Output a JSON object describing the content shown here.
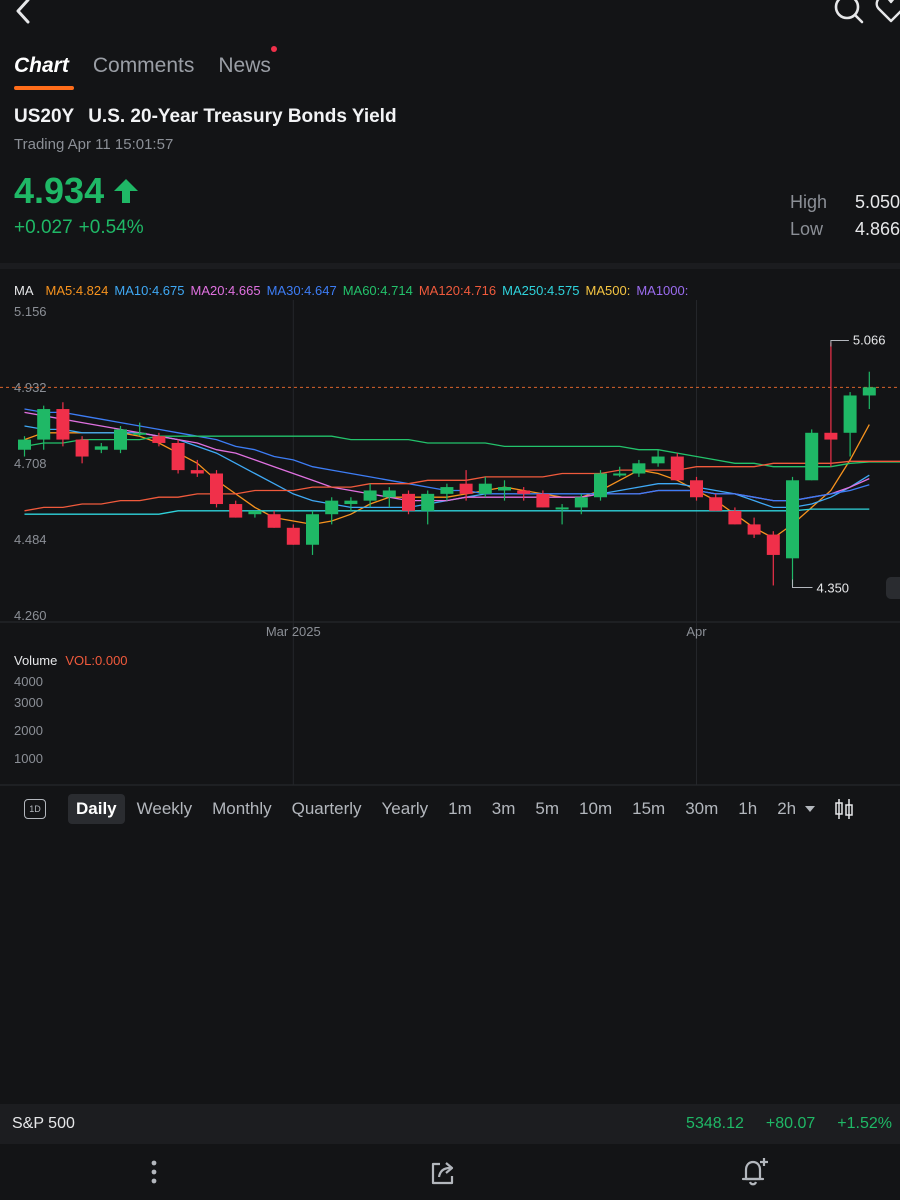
{
  "header": {
    "back_icon": "chevron-left-icon",
    "search_icon": "search-icon",
    "favorite_icon": "heart-icon"
  },
  "tabs": [
    {
      "label": "Chart",
      "active": true
    },
    {
      "label": "Comments",
      "active": false
    },
    {
      "label": "News",
      "active": false,
      "has_dot": true
    }
  ],
  "quote": {
    "symbol": "US20Y",
    "name": "U.S. 20-Year Treasury Bonds Yield",
    "status": "Trading Apr 11 15:01:57",
    "price": "4.934",
    "change": "+0.027",
    "change_pct": "+0.54%",
    "high_label": "High",
    "high": "5.050",
    "low_label": "Low",
    "low": "4.866",
    "up_color": "#1fb866",
    "down_color": "#f0304a"
  },
  "ma_legend": {
    "label": "MA",
    "items": [
      {
        "text": "MA5:4.824",
        "color": "#f7931e"
      },
      {
        "text": "MA10:4.675",
        "color": "#3fa9f5"
      },
      {
        "text": "MA20:4.665",
        "color": "#e071e0"
      },
      {
        "text": "MA30:4.647",
        "color": "#3d7df5"
      },
      {
        "text": "MA60:4.714",
        "color": "#23c26b"
      },
      {
        "text": "MA120:4.716",
        "color": "#f05a3c"
      },
      {
        "text": "MA250:4.575",
        "color": "#2fd3dc"
      },
      {
        "text": "MA500:",
        "color": "#f5c542"
      },
      {
        "text": "MA1000:",
        "color": "#9b6cf0"
      }
    ]
  },
  "chart_data": {
    "type": "candlestick",
    "y_ticks": [
      "5.156",
      "4.932",
      "4.708",
      "4.484",
      "4.260"
    ],
    "ylim": [
      4.26,
      5.156
    ],
    "x_labels": [
      {
        "text": "Mar 2025",
        "index": 14
      },
      {
        "text": "Apr",
        "index": 35
      }
    ],
    "current_price": 4.934,
    "high_marker": {
      "text": "5.066",
      "index": 42
    },
    "low_marker": {
      "text": "4.350",
      "index": 39
    },
    "candles": [
      {
        "o": 4.75,
        "h": 4.79,
        "l": 4.73,
        "c": 4.78
      },
      {
        "o": 4.78,
        "h": 4.88,
        "l": 4.75,
        "c": 4.87
      },
      {
        "o": 4.87,
        "h": 4.89,
        "l": 4.76,
        "c": 4.78
      },
      {
        "o": 4.78,
        "h": 4.79,
        "l": 4.71,
        "c": 4.73
      },
      {
        "o": 4.75,
        "h": 4.77,
        "l": 4.74,
        "c": 4.76
      },
      {
        "o": 4.75,
        "h": 4.82,
        "l": 4.74,
        "c": 4.81
      },
      {
        "o": 4.8,
        "h": 4.83,
        "l": 4.79,
        "c": 4.8
      },
      {
        "o": 4.79,
        "h": 4.8,
        "l": 4.76,
        "c": 4.77
      },
      {
        "o": 4.77,
        "h": 4.78,
        "l": 4.68,
        "c": 4.69
      },
      {
        "o": 4.69,
        "h": 4.72,
        "l": 4.67,
        "c": 4.68
      },
      {
        "o": 4.68,
        "h": 4.69,
        "l": 4.58,
        "c": 4.59
      },
      {
        "o": 4.59,
        "h": 4.6,
        "l": 4.55,
        "c": 4.55
      },
      {
        "o": 4.56,
        "h": 4.57,
        "l": 4.55,
        "c": 4.57
      },
      {
        "o": 4.56,
        "h": 4.57,
        "l": 4.52,
        "c": 4.52
      },
      {
        "o": 4.52,
        "h": 4.53,
        "l": 4.47,
        "c": 4.47
      },
      {
        "o": 4.47,
        "h": 4.57,
        "l": 4.44,
        "c": 4.56
      },
      {
        "o": 4.56,
        "h": 4.61,
        "l": 4.53,
        "c": 4.6
      },
      {
        "o": 4.59,
        "h": 4.61,
        "l": 4.57,
        "c": 4.6
      },
      {
        "o": 4.6,
        "h": 4.65,
        "l": 4.58,
        "c": 4.63
      },
      {
        "o": 4.61,
        "h": 4.64,
        "l": 4.58,
        "c": 4.63
      },
      {
        "o": 4.62,
        "h": 4.63,
        "l": 4.56,
        "c": 4.57
      },
      {
        "o": 4.57,
        "h": 4.63,
        "l": 4.53,
        "c": 4.62
      },
      {
        "o": 4.62,
        "h": 4.65,
        "l": 4.6,
        "c": 4.64
      },
      {
        "o": 4.65,
        "h": 4.69,
        "l": 4.6,
        "c": 4.62
      },
      {
        "o": 4.62,
        "h": 4.67,
        "l": 4.61,
        "c": 4.65
      },
      {
        "o": 4.63,
        "h": 4.66,
        "l": 4.6,
        "c": 4.64
      },
      {
        "o": 4.63,
        "h": 4.64,
        "l": 4.6,
        "c": 4.62
      },
      {
        "o": 4.62,
        "h": 4.63,
        "l": 4.58,
        "c": 4.58
      },
      {
        "o": 4.58,
        "h": 4.59,
        "l": 4.53,
        "c": 4.58
      },
      {
        "o": 4.58,
        "h": 4.62,
        "l": 4.56,
        "c": 4.61
      },
      {
        "o": 4.61,
        "h": 4.69,
        "l": 4.6,
        "c": 4.68
      },
      {
        "o": 4.68,
        "h": 4.7,
        "l": 4.67,
        "c": 4.68
      },
      {
        "o": 4.68,
        "h": 4.72,
        "l": 4.67,
        "c": 4.71
      },
      {
        "o": 4.71,
        "h": 4.75,
        "l": 4.7,
        "c": 4.73
      },
      {
        "o": 4.73,
        "h": 4.74,
        "l": 4.66,
        "c": 4.66
      },
      {
        "o": 4.66,
        "h": 4.67,
        "l": 4.6,
        "c": 4.61
      },
      {
        "o": 4.61,
        "h": 4.62,
        "l": 4.57,
        "c": 4.57
      },
      {
        "o": 4.57,
        "h": 4.58,
        "l": 4.53,
        "c": 4.53
      },
      {
        "o": 4.53,
        "h": 4.55,
        "l": 4.49,
        "c": 4.5
      },
      {
        "o": 4.5,
        "h": 4.51,
        "l": 4.35,
        "c": 4.44
      },
      {
        "o": 4.43,
        "h": 4.67,
        "l": 4.35,
        "c": 4.66
      },
      {
        "o": 4.66,
        "h": 4.81,
        "l": 4.66,
        "c": 4.8
      },
      {
        "o": 4.8,
        "h": 5.066,
        "l": 4.7,
        "c": 4.78
      },
      {
        "o": 4.8,
        "h": 4.92,
        "l": 4.73,
        "c": 4.91
      },
      {
        "o": 4.91,
        "h": 4.98,
        "l": 4.87,
        "c": 4.934
      }
    ],
    "ma_series": [
      {
        "name": "MA5",
        "color": "#f7931e",
        "values": [
          4.78,
          4.8,
          4.8,
          4.8,
          4.8,
          4.8,
          4.79,
          4.77,
          4.74,
          4.71,
          4.66,
          4.62,
          4.58,
          4.55,
          4.54,
          4.53,
          4.54,
          4.56,
          4.59,
          4.61,
          4.61,
          4.61,
          4.61,
          4.62,
          4.63,
          4.64,
          4.63,
          4.62,
          4.61,
          4.61,
          4.63,
          4.66,
          4.69,
          4.68,
          4.66,
          4.63,
          4.6,
          4.56,
          4.52,
          4.49,
          4.53,
          4.58,
          4.63,
          4.72,
          4.824
        ]
      },
      {
        "name": "MA10",
        "color": "#3fa9f5",
        "values": [
          4.82,
          4.81,
          4.81,
          4.8,
          4.8,
          4.8,
          4.8,
          4.79,
          4.78,
          4.76,
          4.74,
          4.71,
          4.68,
          4.65,
          4.62,
          4.6,
          4.59,
          4.58,
          4.58,
          4.58,
          4.58,
          4.59,
          4.6,
          4.61,
          4.62,
          4.62,
          4.62,
          4.62,
          4.62,
          4.62,
          4.62,
          4.63,
          4.64,
          4.65,
          4.65,
          4.64,
          4.63,
          4.62,
          4.6,
          4.58,
          4.58,
          4.59,
          4.61,
          4.64,
          4.675
        ]
      },
      {
        "name": "MA20",
        "color": "#e071e0",
        "values": [
          4.86,
          4.85,
          4.84,
          4.83,
          4.82,
          4.81,
          4.8,
          4.79,
          4.78,
          4.77,
          4.75,
          4.74,
          4.72,
          4.7,
          4.68,
          4.66,
          4.64,
          4.63,
          4.62,
          4.61,
          4.6,
          4.6,
          4.6,
          4.61,
          4.61,
          4.61,
          4.61,
          4.61,
          4.61,
          4.61,
          4.62,
          4.62,
          4.62,
          4.63,
          4.63,
          4.63,
          4.62,
          4.62,
          4.61,
          4.6,
          4.6,
          4.61,
          4.62,
          4.64,
          4.665
        ]
      },
      {
        "name": "MA30",
        "color": "#3d7df5",
        "values": [
          4.87,
          4.86,
          4.86,
          4.85,
          4.84,
          4.83,
          4.82,
          4.81,
          4.8,
          4.79,
          4.78,
          4.76,
          4.75,
          4.73,
          4.72,
          4.7,
          4.69,
          4.68,
          4.67,
          4.66,
          4.65,
          4.64,
          4.63,
          4.63,
          4.62,
          4.62,
          4.62,
          4.62,
          4.62,
          4.62,
          4.62,
          4.62,
          4.62,
          4.63,
          4.63,
          4.63,
          4.62,
          4.62,
          4.61,
          4.6,
          4.6,
          4.61,
          4.62,
          4.63,
          4.647
        ]
      },
      {
        "name": "MA60",
        "color": "#23c26b",
        "values": [
          4.76,
          4.77,
          4.77,
          4.78,
          4.78,
          4.78,
          4.78,
          4.79,
          4.79,
          4.79,
          4.79,
          4.79,
          4.79,
          4.79,
          4.79,
          4.79,
          4.79,
          4.78,
          4.78,
          4.78,
          4.78,
          4.77,
          4.77,
          4.77,
          4.77,
          4.76,
          4.76,
          4.76,
          4.76,
          4.76,
          4.76,
          4.76,
          4.75,
          4.75,
          4.74,
          4.73,
          4.72,
          4.71,
          4.71,
          4.7,
          4.7,
          4.7,
          4.7,
          4.71,
          4.714
        ]
      },
      {
        "name": "MA120",
        "color": "#f05a3c",
        "values": [
          4.57,
          4.58,
          4.58,
          4.59,
          4.59,
          4.6,
          4.6,
          4.61,
          4.61,
          4.62,
          4.62,
          4.62,
          4.63,
          4.63,
          4.63,
          4.64,
          4.64,
          4.64,
          4.65,
          4.65,
          4.65,
          4.66,
          4.66,
          4.66,
          4.67,
          4.67,
          4.67,
          4.67,
          4.68,
          4.68,
          4.68,
          4.69,
          4.69,
          4.69,
          4.69,
          4.7,
          4.7,
          4.7,
          4.7,
          4.71,
          4.71,
          4.71,
          4.71,
          4.716,
          4.716
        ]
      },
      {
        "name": "MA250",
        "color": "#2fd3dc",
        "values": [
          4.56,
          4.56,
          4.56,
          4.56,
          4.56,
          4.56,
          4.56,
          4.56,
          4.57,
          4.57,
          4.57,
          4.57,
          4.57,
          4.57,
          4.57,
          4.57,
          4.57,
          4.57,
          4.57,
          4.57,
          4.57,
          4.57,
          4.57,
          4.57,
          4.57,
          4.57,
          4.57,
          4.57,
          4.57,
          4.57,
          4.57,
          4.57,
          4.57,
          4.57,
          4.57,
          4.57,
          4.57,
          4.57,
          4.57,
          4.57,
          4.57,
          4.575,
          4.575,
          4.575,
          4.575
        ]
      }
    ],
    "volume": {
      "title": "Volume",
      "value_label": "VOL:0.000",
      "y_ticks": [
        "4000",
        "3000",
        "2000",
        "1000"
      ],
      "values": []
    }
  },
  "periods": {
    "mode_icon": "1D",
    "items": [
      "Daily",
      "Weekly",
      "Monthly",
      "Quarterly",
      "Yearly",
      "1m",
      "3m",
      "5m",
      "10m",
      "15m",
      "30m",
      "1h",
      "2h"
    ],
    "active": "Daily",
    "candle_icon": "candlestick-icon"
  },
  "bottom_ticker": {
    "name": "S&P 500",
    "price": "5348.12",
    "change": "+80.07",
    "change_pct": "+1.52%"
  },
  "bottom_nav": {
    "more_icon": "more-vertical-icon",
    "share_icon": "share-icon",
    "alert_icon": "bell-plus-icon"
  }
}
